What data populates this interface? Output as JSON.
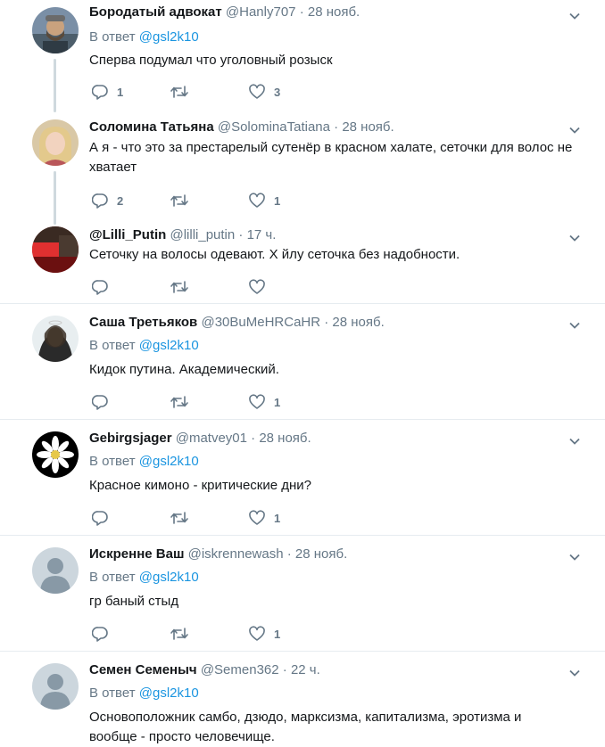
{
  "tweets": [
    {
      "name": "Бородатый адвокат",
      "handle": "@Hanly707",
      "dot": "·",
      "time": "28 нояб.",
      "reply_prefix": "В ответ",
      "reply_to": "@gsl2k10",
      "text": "Сперва подумал что уголовный розыск",
      "replies": "1",
      "retweets": "",
      "likes": "3"
    },
    {
      "name": "Соломина Татьяна",
      "handle": "@SolominaTatiana",
      "dot": "·",
      "time": "28 нояб.",
      "text": "А я - что это за престарелый сутенёр в красном халате, сеточки для волос не хватает",
      "replies": "2",
      "retweets": "",
      "likes": "1"
    },
    {
      "name": "@Lilli_Putin",
      "handle": "@lilli_putin",
      "dot": "·",
      "time": "17 ч.",
      "text": "Сеточку на волосы одевают. Х  йлу сеточка без надобности.",
      "replies": "",
      "retweets": "",
      "likes": ""
    },
    {
      "name": "Саша Третьяков",
      "handle": "@30BuMeHRCaHR",
      "dot": "·",
      "time": "28 нояб.",
      "reply_prefix": "В ответ",
      "reply_to": "@gsl2k10",
      "text": "Кидок путина. Академический.",
      "replies": "",
      "retweets": "",
      "likes": "1"
    },
    {
      "name": "Gebirgsjager",
      "handle": "@matvey01",
      "dot": "·",
      "time": "28 нояб.",
      "reply_prefix": "В ответ",
      "reply_to": "@gsl2k10",
      "text": "Красное кимоно - критические дни?",
      "replies": "",
      "retweets": "",
      "likes": "1"
    },
    {
      "name": "Искренне Ваш",
      "handle": "@iskrennewash",
      "dot": "·",
      "time": "28 нояб.",
      "reply_prefix": "В ответ",
      "reply_to": "@gsl2k10",
      "text": "гр  баный стыд",
      "replies": "",
      "retweets": "",
      "likes": "1"
    },
    {
      "name": "Семен Семеныч",
      "handle": "@Semen362",
      "dot": "·",
      "time": "22 ч.",
      "reply_prefix": "В ответ",
      "reply_to": "@gsl2k10",
      "text": "Основоположник самбо, дзюдо, марксизма, капитализма, эротизма и вообще - просто человечище.",
      "replies": "",
      "retweets": "",
      "likes": ""
    }
  ],
  "icons": {
    "reply": "reply-icon",
    "retweet": "retweet-icon",
    "like": "heart-icon",
    "more": "chevron-down-icon"
  },
  "colors": {
    "text": "#14171a",
    "muted": "#657786",
    "link": "#1b95e0",
    "icon": "#657786",
    "separator": "#e6ecf0",
    "thread_line": "#cfd9de"
  }
}
